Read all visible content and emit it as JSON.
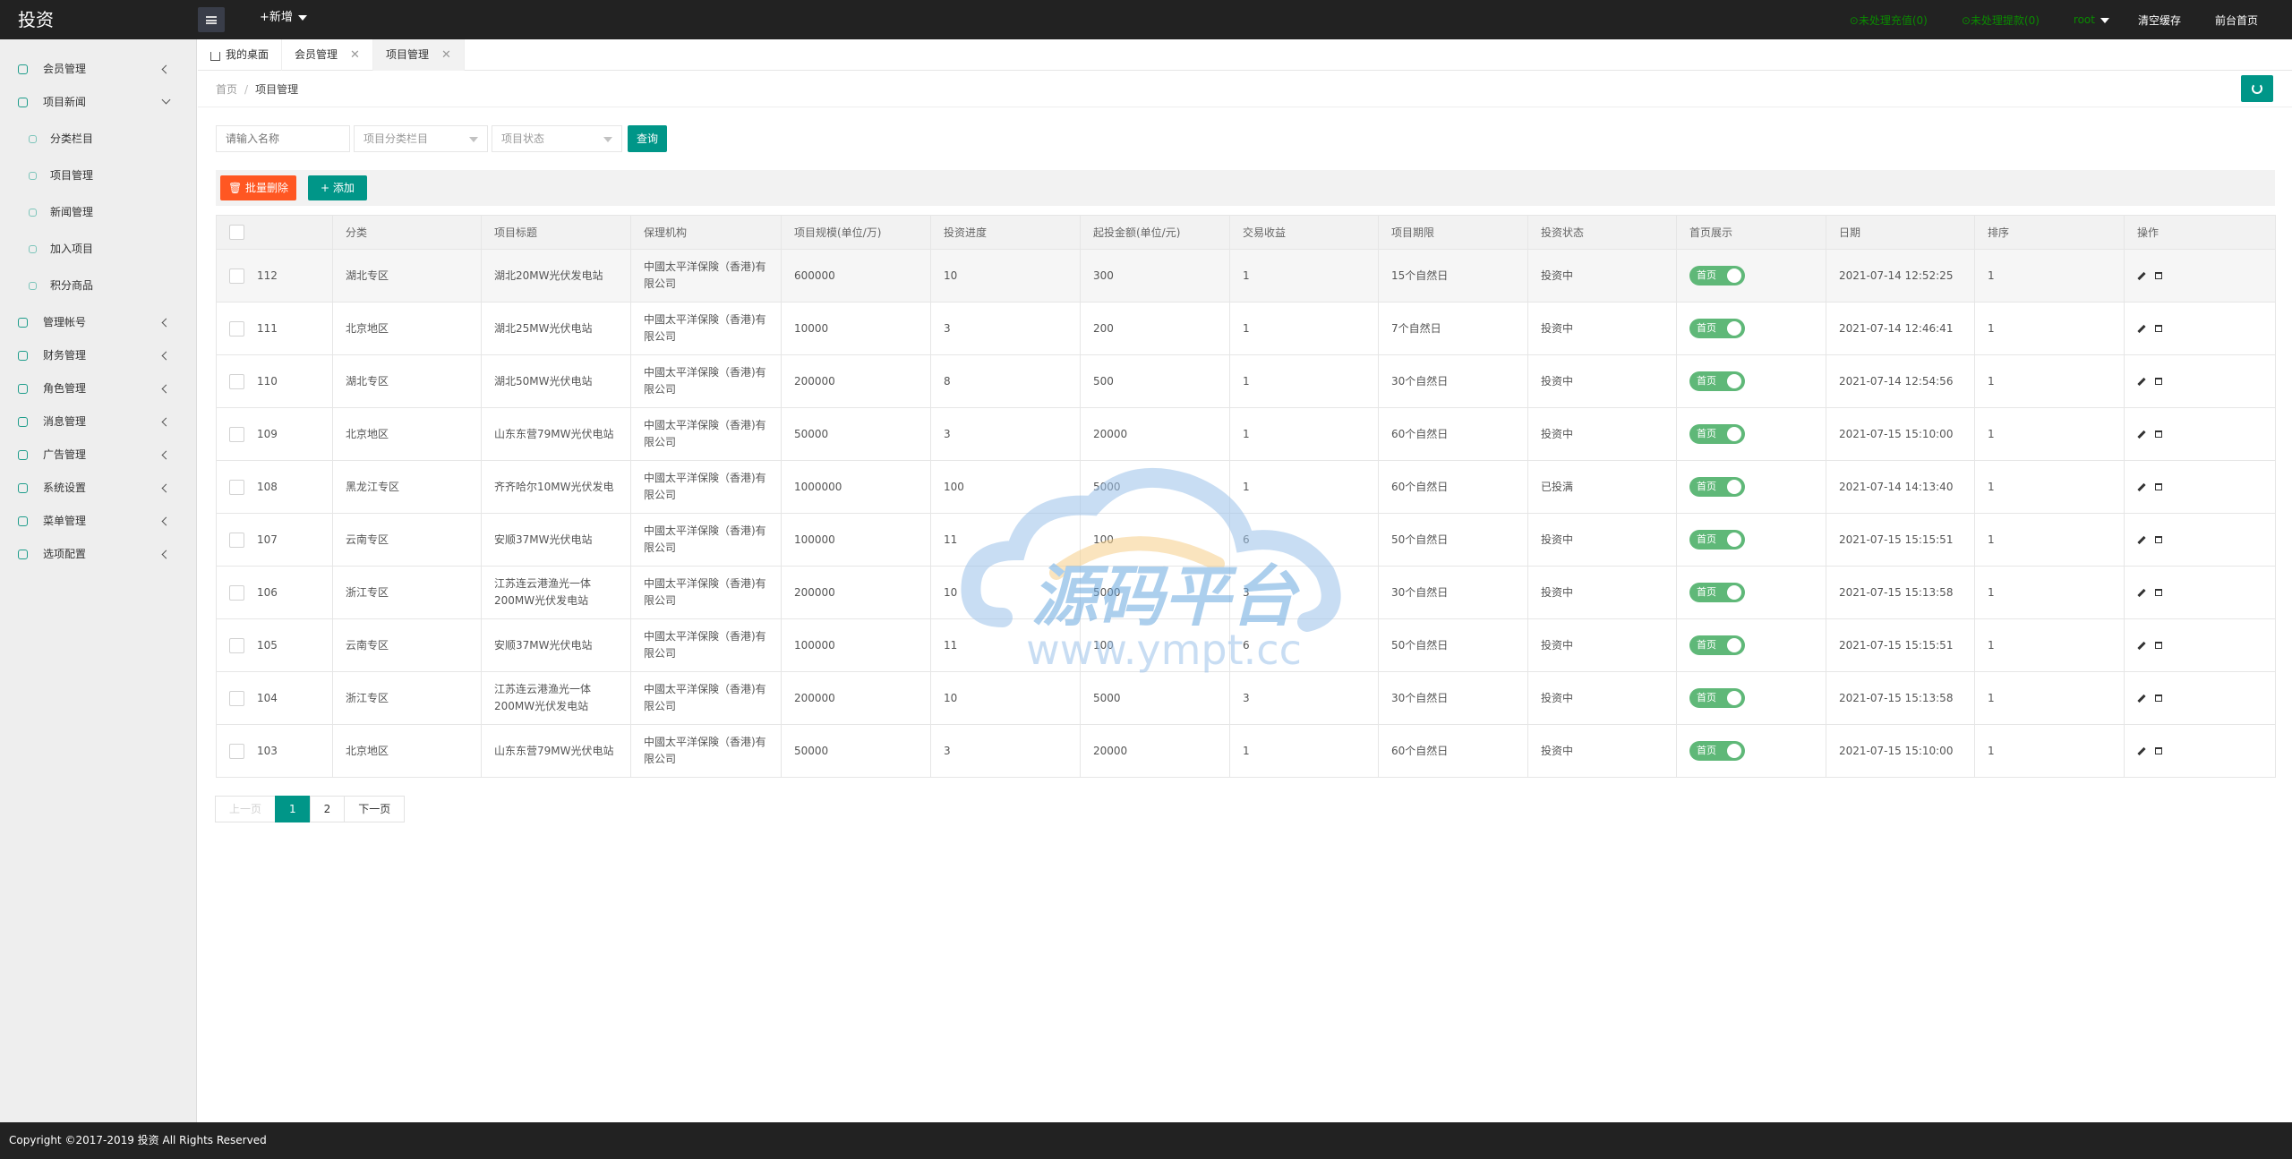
{
  "header": {
    "logo": "投资",
    "add_new": "+新增",
    "unprocessed_recharge": "⊙未处理充值(0)",
    "unprocessed_withdraw": "⊙未处理提款(0)",
    "user": "root",
    "clear_cache": "清空缓存",
    "front_home": "前台首页"
  },
  "sidebar": {
    "items": [
      {
        "label": "会员管理",
        "icon": "user-icon"
      },
      {
        "label": "项目新闻",
        "icon": "book-icon",
        "expanded": true
      },
      {
        "label": "管理帐号",
        "icon": "account-icon"
      },
      {
        "label": "财务管理",
        "icon": "finance-icon"
      },
      {
        "label": "角色管理",
        "icon": "role-icon"
      },
      {
        "label": "消息管理",
        "icon": "message-icon"
      },
      {
        "label": "广告管理",
        "icon": "ad-icon"
      },
      {
        "label": "系统设置",
        "icon": "settings-icon"
      },
      {
        "label": "菜单管理",
        "icon": "menu-icon"
      },
      {
        "label": "选项配置",
        "icon": "option-icon"
      }
    ],
    "sub_items": [
      {
        "label": "分类栏目"
      },
      {
        "label": "项目管理"
      },
      {
        "label": "新闻管理"
      },
      {
        "label": "加入项目"
      },
      {
        "label": "积分商品"
      }
    ]
  },
  "tabs": [
    {
      "label": "我的桌面"
    },
    {
      "label": "会员管理",
      "close": "✕"
    },
    {
      "label": "项目管理",
      "close": "✕"
    }
  ],
  "breadcrumb": {
    "home": "首页",
    "sep": "/",
    "current": "项目管理"
  },
  "search": {
    "name_placeholder": "请输入名称",
    "category_placeholder": "项目分类栏目",
    "status_placeholder": "项目状态",
    "query_label": "查询"
  },
  "toolbar": {
    "batch_delete": "批量删除",
    "add": "添加"
  },
  "table": {
    "headers": [
      "分类",
      "项目标题",
      "保理机构",
      "项目规模(单位/万)",
      "投资进度",
      "起投金额(单位/元)",
      "交易收益",
      "项目期限",
      "投资状态",
      "首页展示",
      "日期",
      "排序",
      "操作"
    ],
    "switch_label": "首页",
    "rows": [
      {
        "id": "112",
        "category": "湖北专区",
        "title": "湖北20MW光伏发电站",
        "org": "中國太平洋保険（香港)有限公司",
        "scale": "600000",
        "progress": "10",
        "min_invest": "300",
        "yield": "1",
        "term": "15个自然日",
        "status": "投资中",
        "date": "2021-07-14 12:52:25",
        "sort": "1"
      },
      {
        "id": "111",
        "category": "北京地区",
        "title": "湖北25MW光伏电站",
        "org": "中國太平洋保険（香港)有限公司",
        "scale": "10000",
        "progress": "3",
        "min_invest": "200",
        "yield": "1",
        "term": "7个自然日",
        "status": "投资中",
        "date": "2021-07-14 12:46:41",
        "sort": "1"
      },
      {
        "id": "110",
        "category": "湖北专区",
        "title": "湖北50MW光伏电站",
        "org": "中國太平洋保険（香港)有限公司",
        "scale": "200000",
        "progress": "8",
        "min_invest": "500",
        "yield": "1",
        "term": "30个自然日",
        "status": "投资中",
        "date": "2021-07-14 12:54:56",
        "sort": "1"
      },
      {
        "id": "109",
        "category": "北京地区",
        "title": "山东东营79MW光伏电站",
        "org": "中國太平洋保険（香港)有限公司",
        "scale": "50000",
        "progress": "3",
        "min_invest": "20000",
        "yield": "1",
        "term": "60个自然日",
        "status": "投资中",
        "date": "2021-07-15 15:10:00",
        "sort": "1"
      },
      {
        "id": "108",
        "category": "黑龙江专区",
        "title": "齐齐哈尔10MW光伏发电",
        "org": "中國太平洋保険（香港)有限公司",
        "scale": "1000000",
        "progress": "100",
        "min_invest": "5000",
        "yield": "1",
        "term": "60个自然日",
        "status": "已投满",
        "date": "2021-07-14 14:13:40",
        "sort": "1"
      },
      {
        "id": "107",
        "category": "云南专区",
        "title": "安顺37MW光伏电站",
        "org": "中國太平洋保険（香港)有限公司",
        "scale": "100000",
        "progress": "11",
        "min_invest": "100",
        "yield": "6",
        "term": "50个自然日",
        "status": "投资中",
        "date": "2021-07-15 15:15:51",
        "sort": "1"
      },
      {
        "id": "106",
        "category": "浙江专区",
        "title": "江苏连云港渔光一体200MW光伏发电站",
        "org": "中國太平洋保険（香港)有限公司",
        "scale": "200000",
        "progress": "10",
        "min_invest": "5000",
        "yield": "3",
        "term": "30个自然日",
        "status": "投资中",
        "date": "2021-07-15 15:13:58",
        "sort": "1"
      },
      {
        "id": "105",
        "category": "云南专区",
        "title": "安顺37MW光伏电站",
        "org": "中國太平洋保険（香港)有限公司",
        "scale": "100000",
        "progress": "11",
        "min_invest": "100",
        "yield": "6",
        "term": "50个自然日",
        "status": "投资中",
        "date": "2021-07-15 15:15:51",
        "sort": "1"
      },
      {
        "id": "104",
        "category": "浙江专区",
        "title": "江苏连云港渔光一体200MW光伏发电站",
        "org": "中國太平洋保険（香港)有限公司",
        "scale": "200000",
        "progress": "10",
        "min_invest": "5000",
        "yield": "3",
        "term": "30个自然日",
        "status": "投资中",
        "date": "2021-07-15 15:13:58",
        "sort": "1"
      },
      {
        "id": "103",
        "category": "北京地区",
        "title": "山东东营79MW光伏电站",
        "org": "中國太平洋保険（香港)有限公司",
        "scale": "50000",
        "progress": "3",
        "min_invest": "20000",
        "yield": "1",
        "term": "60个自然日",
        "status": "投资中",
        "date": "2021-07-15 15:10:00",
        "sort": "1"
      }
    ]
  },
  "pagination": {
    "prev": "上一页",
    "pages": [
      "1",
      "2"
    ],
    "current": "1",
    "next": "下一页"
  },
  "watermark": {
    "text": "源码平台",
    "url": "www.ympt.cc"
  },
  "footer": {
    "copyright": "Copyright ©2017-2019 投资 All Rights Reserved"
  },
  "colors": {
    "primary": "#009688",
    "danger": "#ff5722",
    "switch": "#5fb878",
    "header": "#222222"
  }
}
